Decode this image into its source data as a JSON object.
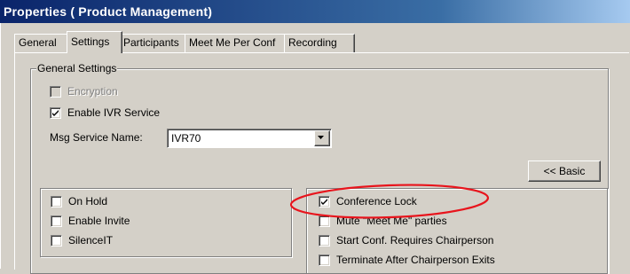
{
  "window": {
    "title": "Properties  ( Product Management)"
  },
  "tabs": [
    {
      "label": "General",
      "active": false
    },
    {
      "label": "Settings",
      "active": true
    },
    {
      "label": "Participants",
      "active": false
    },
    {
      "label": "Meet Me Per Conf",
      "active": false
    },
    {
      "label": "Recording",
      "active": false
    }
  ],
  "general_settings": {
    "legend": "General Settings",
    "encryption": {
      "label": "Encryption",
      "checked": false,
      "disabled": true
    },
    "enable_ivr": {
      "label": "Enable IVR Service",
      "checked": true,
      "disabled": false
    },
    "msg_service": {
      "label": "Msg Service Name:",
      "value": "IVR70"
    }
  },
  "basic_button": {
    "label": "<< Basic"
  },
  "left_group": {
    "items": [
      {
        "label": "On Hold",
        "checked": false
      },
      {
        "label": "Enable Invite",
        "checked": false
      },
      {
        "label": "SilenceIT",
        "checked": false
      }
    ]
  },
  "right_group": {
    "items": [
      {
        "label": "Conference Lock",
        "checked": true
      },
      {
        "label": "Mute \"Meet Me\" parties",
        "checked": false
      },
      {
        "label": "Start Conf. Requires Chairperson",
        "checked": false
      },
      {
        "label": "Terminate After Chairperson Exits",
        "checked": false
      }
    ]
  },
  "colors": {
    "title_bar_start": "#0a246a",
    "title_bar_end": "#a6caf0",
    "dialog_face": "#d4d0c8",
    "annotation": "#e8141c"
  }
}
